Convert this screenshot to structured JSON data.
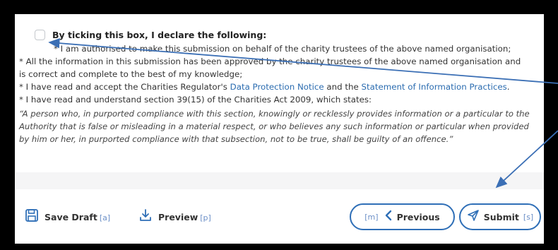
{
  "declaration": {
    "heading": "By ticking this box, I declare the following:",
    "line1": "* I am authorised to make this submission on behalf of the charity trustees of the above named organisation;",
    "line2": "* All the information in this submission has been approved by the charity trustees of the above named organisation and",
    "line3": "is correct and complete to the best of my knowledge;",
    "line4_prefix": "* I have read and accept the Charities Regulator's ",
    "line4_link1": "Data Protection Notice",
    "line4_mid": " and the ",
    "line4_link2": "Statement of Information Practices",
    "line4_suffix": ".",
    "line5": "* I have read and understand section 39(15) of the Charities Act 2009, which states:",
    "quote": "“A person who, in purported compliance with this section, knowingly or recklessly provides information or a particular to the Authority that is false or misleading in a material respect, or who believes any such information or particular when provided by him or her, in purported compliance with that subsection, not to be true, shall be guilty of an offence.”",
    "checked": false
  },
  "footer": {
    "save_draft": {
      "label": "Save Draft",
      "shortcut": "[a]"
    },
    "preview": {
      "label": "Preview",
      "shortcut": "[p]"
    },
    "previous": {
      "label": "Previous",
      "shortcut": "[m]"
    },
    "submit": {
      "label": "Submit",
      "shortcut": "[s]"
    }
  },
  "colors": {
    "accent": "#2f6fb7",
    "link": "#2b6cb0",
    "shortcut": "#6b8fc7",
    "annotation_arrow": "#3b6fb5"
  },
  "icons": [
    "save-icon",
    "download-icon",
    "chevron-left-icon",
    "send-icon"
  ]
}
